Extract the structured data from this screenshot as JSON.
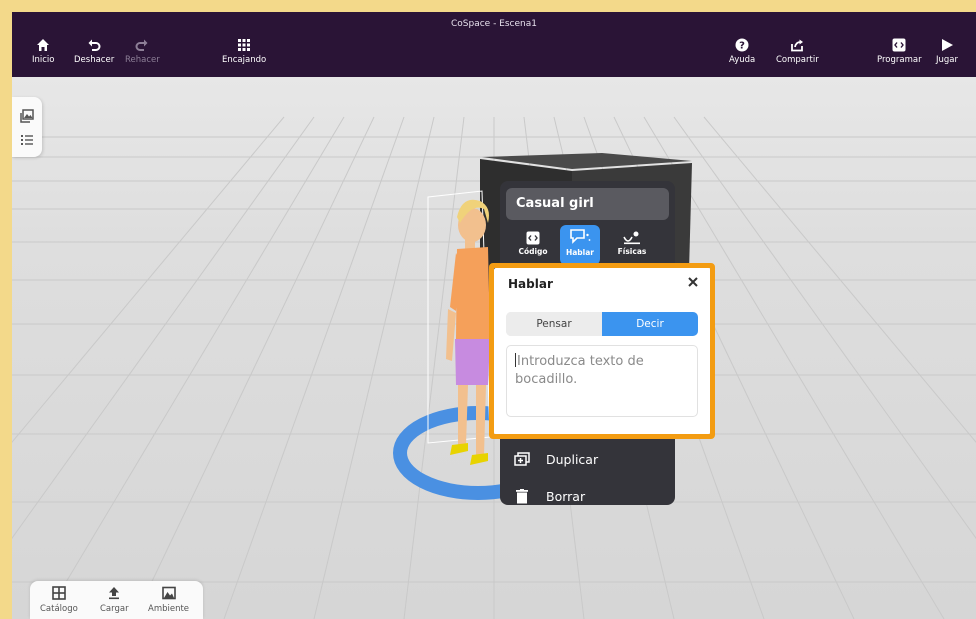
{
  "app": {
    "title": "CoSpace - Escena1"
  },
  "toolbar": {
    "left": [
      {
        "label": "Inicio",
        "icon": "home-icon"
      },
      {
        "label": "Deshacer",
        "icon": "undo-icon"
      },
      {
        "label": "Rehacer",
        "icon": "redo-icon",
        "disabled": true
      },
      {
        "label": "Encajando",
        "icon": "grid-snap-icon"
      }
    ],
    "right": [
      {
        "label": "Ayuda",
        "icon": "help-icon"
      },
      {
        "label": "Compartir",
        "icon": "share-icon"
      },
      {
        "label": "Programar",
        "icon": "code-icon"
      },
      {
        "label": "Jugar",
        "icon": "play-icon"
      }
    ]
  },
  "left_panel": {
    "icons": [
      "gallery-icon",
      "list-icon"
    ]
  },
  "bottom_panel": {
    "items": [
      {
        "label": "Catálogo",
        "icon": "catalog-icon"
      },
      {
        "label": "Cargar",
        "icon": "upload-icon"
      },
      {
        "label": "Ambiente",
        "icon": "environment-icon"
      }
    ]
  },
  "object_menu": {
    "name": "Casual girl",
    "tabs": [
      {
        "label": "Código",
        "icon": "code-icon"
      },
      {
        "label": "Hablar",
        "icon": "speech-bubble-icon",
        "active": true
      },
      {
        "label": "Físicas",
        "icon": "physics-icon"
      }
    ],
    "items": [
      {
        "label": "Duplicar",
        "icon": "duplicate-icon"
      },
      {
        "label": "Borrar",
        "icon": "trash-icon"
      }
    ]
  },
  "speak_dialog": {
    "title": "Hablar",
    "options": [
      "Pensar",
      "Decir"
    ],
    "selected": "Decir",
    "placeholder": "Introduzca texto de bocadillo."
  },
  "colors": {
    "topbar": "#2a1436",
    "accent": "#3b94ef",
    "highlight": "#f39c12",
    "selection_ring": "#4a90e2"
  }
}
